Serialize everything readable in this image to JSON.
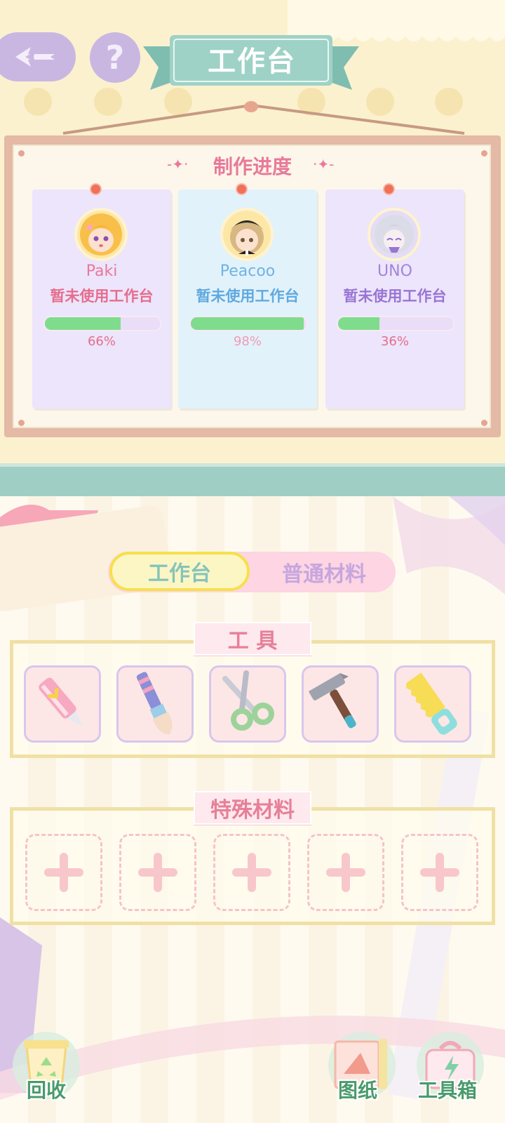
{
  "header": {
    "title": "工作台",
    "back_icon": "back-arrow-icon",
    "help_symbol": "?"
  },
  "progress_board": {
    "title": "制作进度",
    "cards": [
      {
        "name": "Paki",
        "status": "暂未使用工作台",
        "progress": 0.66,
        "percent_label": "66%",
        "bg": "#ece5fb",
        "name_color": "#e8799a",
        "status_color": "#e56d8d",
        "pct_color": "#e56d8d"
      },
      {
        "name": "Peacoo",
        "status": "暂未使用工作台",
        "progress": 0.98,
        "percent_label": "98%",
        "bg": "#e2f2fb",
        "name_color": "#6fb3e3",
        "status_color": "#5fa9df",
        "pct_color": "#f19bb5"
      },
      {
        "name": "UNO",
        "status": "暂未使用工作台",
        "progress": 0.36,
        "percent_label": "36%",
        "bg": "#ece5fb",
        "name_color": "#a484d9",
        "status_color": "#9a74d4",
        "pct_color": "#e56d8d"
      }
    ]
  },
  "tabs": {
    "workbench": "工作台",
    "materials": "普通材料",
    "active": "workbench"
  },
  "tools": {
    "label": "工 具",
    "items": [
      "utility-knife-icon",
      "paintbrush-icon",
      "scissors-icon",
      "hammer-icon",
      "saw-icon"
    ]
  },
  "special_materials": {
    "label": "特殊材料",
    "slot_count": 5,
    "slot_symbol": "+"
  },
  "bottom_buttons": {
    "recycle": "回收",
    "blueprint": "图纸",
    "toolbox": "工具箱"
  },
  "colors": {
    "accent_teal": "#9fcfc4",
    "progress_green": "#7fdc8c",
    "pink_label": "#e77f98",
    "tab_highlight": "#f6e04a"
  }
}
